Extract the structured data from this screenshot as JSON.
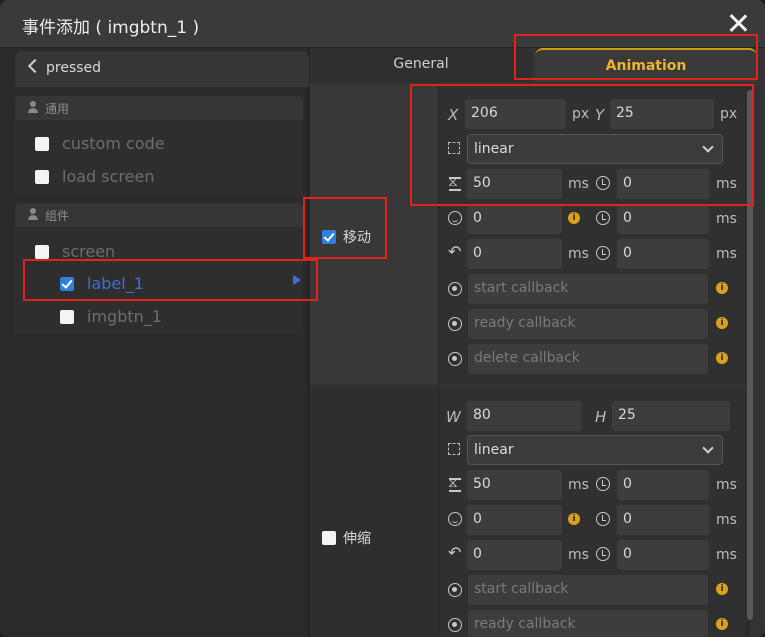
{
  "window": {
    "title": "事件添加 ( imgbtn_1 )"
  },
  "left": {
    "back_label": "pressed",
    "groups": [
      {
        "title": "通用",
        "items": [
          {
            "label": "custom code",
            "checked": false
          },
          {
            "label": "load screen",
            "checked": false
          }
        ]
      },
      {
        "title": "组件",
        "items": [
          {
            "label": "screen",
            "checked": false
          },
          {
            "label": "label_1",
            "checked": true
          },
          {
            "label": "imgbtn_1",
            "checked": false
          }
        ]
      }
    ]
  },
  "tabs": [
    {
      "label": "General"
    },
    {
      "label": "Animation"
    }
  ],
  "move": {
    "label": "移动",
    "checked": true,
    "x_label": "X",
    "x_value": "206",
    "x_unit": "px",
    "y_label": "Y",
    "y_value": "25",
    "y_unit": "px",
    "path": "linear",
    "time": "50",
    "time_unit": "ms",
    "delay": "0",
    "delay_unit": "ms",
    "playback": "0",
    "playback_delay": "0",
    "playback_unit": "ms",
    "repeat": "0",
    "repeat_unit": "ms",
    "repeat_delay": "0",
    "repeat_delay_unit": "ms",
    "start_callback": "start callback",
    "ready_callback": "ready callback",
    "delete_callback": "delete callback"
  },
  "scale": {
    "label": "伸缩",
    "checked": false,
    "w_label": "W",
    "w_value": "80",
    "h_label": "H",
    "h_value": "25",
    "path": "linear",
    "time": "50",
    "time_unit": "ms",
    "delay": "0",
    "delay_unit": "ms",
    "playback": "0",
    "playback_delay": "0",
    "playback_unit": "ms",
    "repeat": "0",
    "repeat_unit": "ms",
    "repeat_delay": "0",
    "repeat_delay_unit": "ms",
    "start_callback": "start callback",
    "ready_callback": "ready callback"
  },
  "info_glyph": "i",
  "colors": {
    "accent": "#f3b32c",
    "highlight": "#e3221e",
    "check": "#2f7fe0",
    "active_text": "#3d6fd6"
  }
}
